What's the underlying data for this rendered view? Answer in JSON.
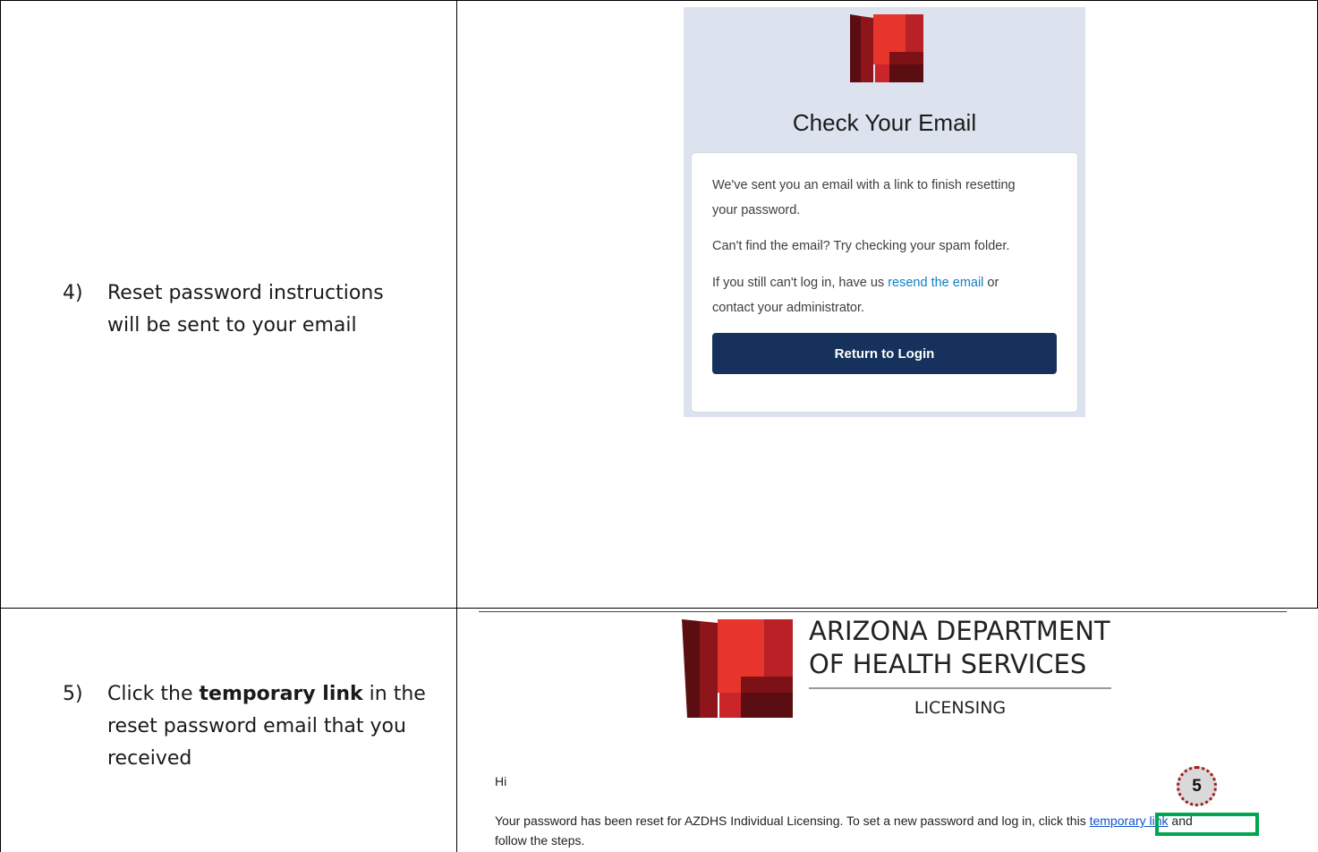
{
  "rows": [
    {
      "number": "4)",
      "instruction_lines": [
        "Reset password instructions",
        "will be sent to your email"
      ]
    },
    {
      "number": "5)",
      "instruction_pre": "Click the ",
      "instruction_bold": "temporary link",
      "instruction_post": " in the",
      "instruction_line2": "reset password email that you",
      "instruction_line3": "received"
    }
  ],
  "check_email": {
    "title": "Check Your Email",
    "line1": "We've sent you an email with a link to finish resetting",
    "line2": "your password.",
    "line3": "Can't find the email? Try checking your spam folder.",
    "line4_pre": "If you still can't log in, have us ",
    "line4_link": "resend the email",
    "line4_post": " or",
    "line5": "contact your administrator.",
    "button": "Return to Login",
    "colors": {
      "panel_bg": "#dce3ee",
      "button_bg": "#16325c",
      "link": "#0f7fc4"
    }
  },
  "email": {
    "brand_line1": "ARIZONA DEPARTMENT",
    "brand_line2": "OF HEALTH SERVICES",
    "brand_sub": "LICENSING",
    "greeting": "Hi",
    "body_pre": "Your password has been reset for AZDHS Individual Licensing. To set a new password and log in, click this ",
    "body_link": "temporary link",
    "body_post": " and",
    "body_line2": "follow the steps.",
    "step_badge": "5",
    "colors": {
      "callout": "#00a650",
      "badge_border": "#a11a1a"
    }
  }
}
